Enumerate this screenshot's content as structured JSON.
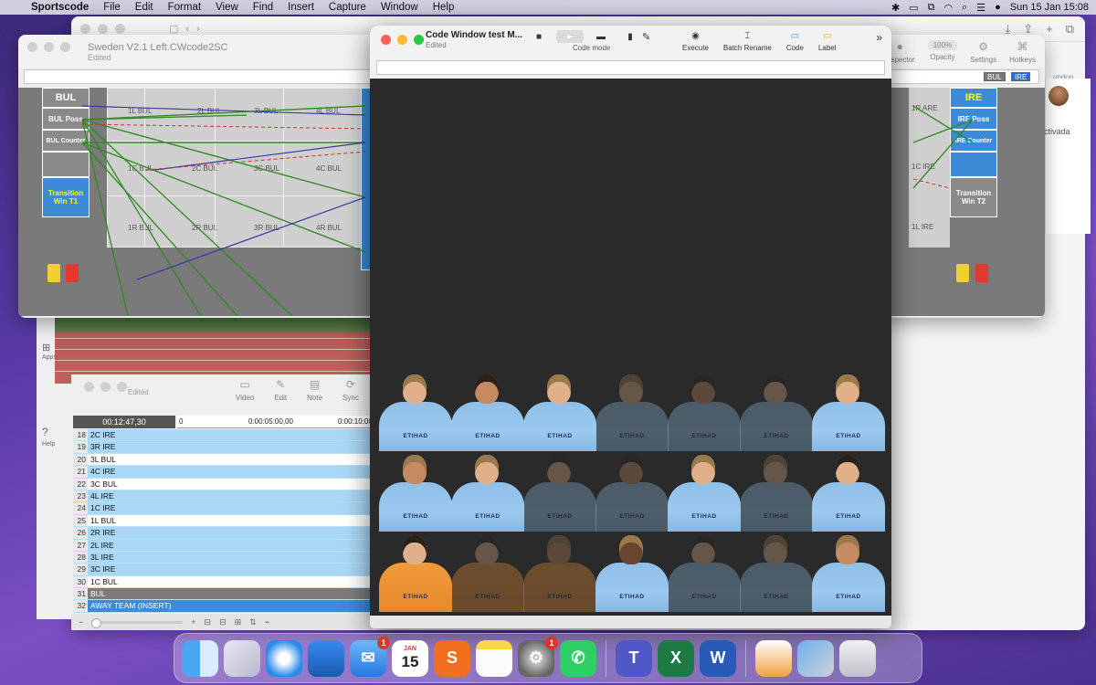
{
  "menubar": {
    "app_name": "Sportscode",
    "items": [
      "File",
      "Edit",
      "Format",
      "View",
      "Find",
      "Insert",
      "Capture",
      "Window",
      "Help"
    ],
    "clock": "Sun 15 Jan  15:08"
  },
  "sweden_window": {
    "title": "Sweden V2.1 Left.CWcode2SC",
    "subtitle": "Edited",
    "toolbar": {
      "inspector": "Inspector",
      "zoom": "100%",
      "opacity": "Opacity",
      "settings": "Settings",
      "hotkeys": "Hotkeys"
    },
    "left_team": {
      "name": "BUL",
      "cells": [
        "BUL Poss",
        "BUL Counter",
        "",
        "Transition Win T1"
      ]
    },
    "right_team": {
      "name": "IRE",
      "cells": [
        "IRE Poss",
        "IRE Counter",
        "",
        "Transition Win T2"
      ]
    },
    "zones": [
      "1L BUL",
      "2L BUL",
      "3L BUL",
      "4L BUL",
      "1C BUL",
      "2C BUL",
      "3C BUL",
      "4C BUL",
      "1R BUL",
      "2R BUL",
      "3R BUL",
      "4R BUL"
    ],
    "right_zones": [
      "1R ARE",
      "1C IRE",
      "1L IRE"
    ],
    "selectors": [
      "BUL",
      "IRE"
    ],
    "side_text": "ctivada",
    "side_text2": "undog..."
  },
  "timeline": {
    "toolbar": [
      "Video",
      "Edit",
      "Note",
      "Sync"
    ],
    "edited": "Edited",
    "timecode": "00:12:47,30",
    "ruler": [
      "0",
      "0:00:05:00,00",
      "0:00:10:00,"
    ],
    "rows": [
      {
        "num": "18",
        "label": "2C IRE",
        "style": "blue-light"
      },
      {
        "num": "19",
        "label": "3R IRE",
        "style": "blue-light"
      },
      {
        "num": "20",
        "label": "3L BUL",
        "style": "white"
      },
      {
        "num": "21",
        "label": "4C IRE",
        "style": "blue-light"
      },
      {
        "num": "22",
        "label": "3C BUL",
        "style": "white"
      },
      {
        "num": "23",
        "label": "4L IRE",
        "style": "blue-light"
      },
      {
        "num": "24",
        "label": "1C IRE",
        "style": "blue-light"
      },
      {
        "num": "25",
        "label": "1L BUL",
        "style": "white"
      },
      {
        "num": "26",
        "label": "2R IRE",
        "style": "blue-light"
      },
      {
        "num": "27",
        "label": "2L IRE",
        "style": "blue-light"
      },
      {
        "num": "28",
        "label": "3L IRE",
        "style": "blue-light"
      },
      {
        "num": "29",
        "label": "3C IRE",
        "style": "blue-light"
      },
      {
        "num": "30",
        "label": "1C BUL",
        "style": "white"
      },
      {
        "num": "31",
        "label": "BUL",
        "style": "dark"
      },
      {
        "num": "32",
        "label": "AWAY TEAM (INSERT)",
        "style": "blue"
      }
    ]
  },
  "left_strip": {
    "apps": "Apps",
    "help": "Help"
  },
  "code_window": {
    "title": "Code Window test M...",
    "subtitle": "Edited",
    "mode_label": "Code mode",
    "tools": [
      "Execute",
      "Batch Rename",
      "Code",
      "Label"
    ],
    "sponsor": "ETIHAD"
  },
  "dock": {
    "calendar_month": "JAN",
    "calendar_day": "15",
    "mail_badge": "1",
    "prefs_badge": "1",
    "apps": [
      "Finder",
      "Launchpad",
      "Safari",
      "Keynote",
      "Mail",
      "Calendar",
      "Sportscode",
      "Notes",
      "System Preferences",
      "WhatsApp",
      "Teams",
      "Excel",
      "Word",
      "Photo",
      "Downloads",
      "Trash"
    ]
  }
}
